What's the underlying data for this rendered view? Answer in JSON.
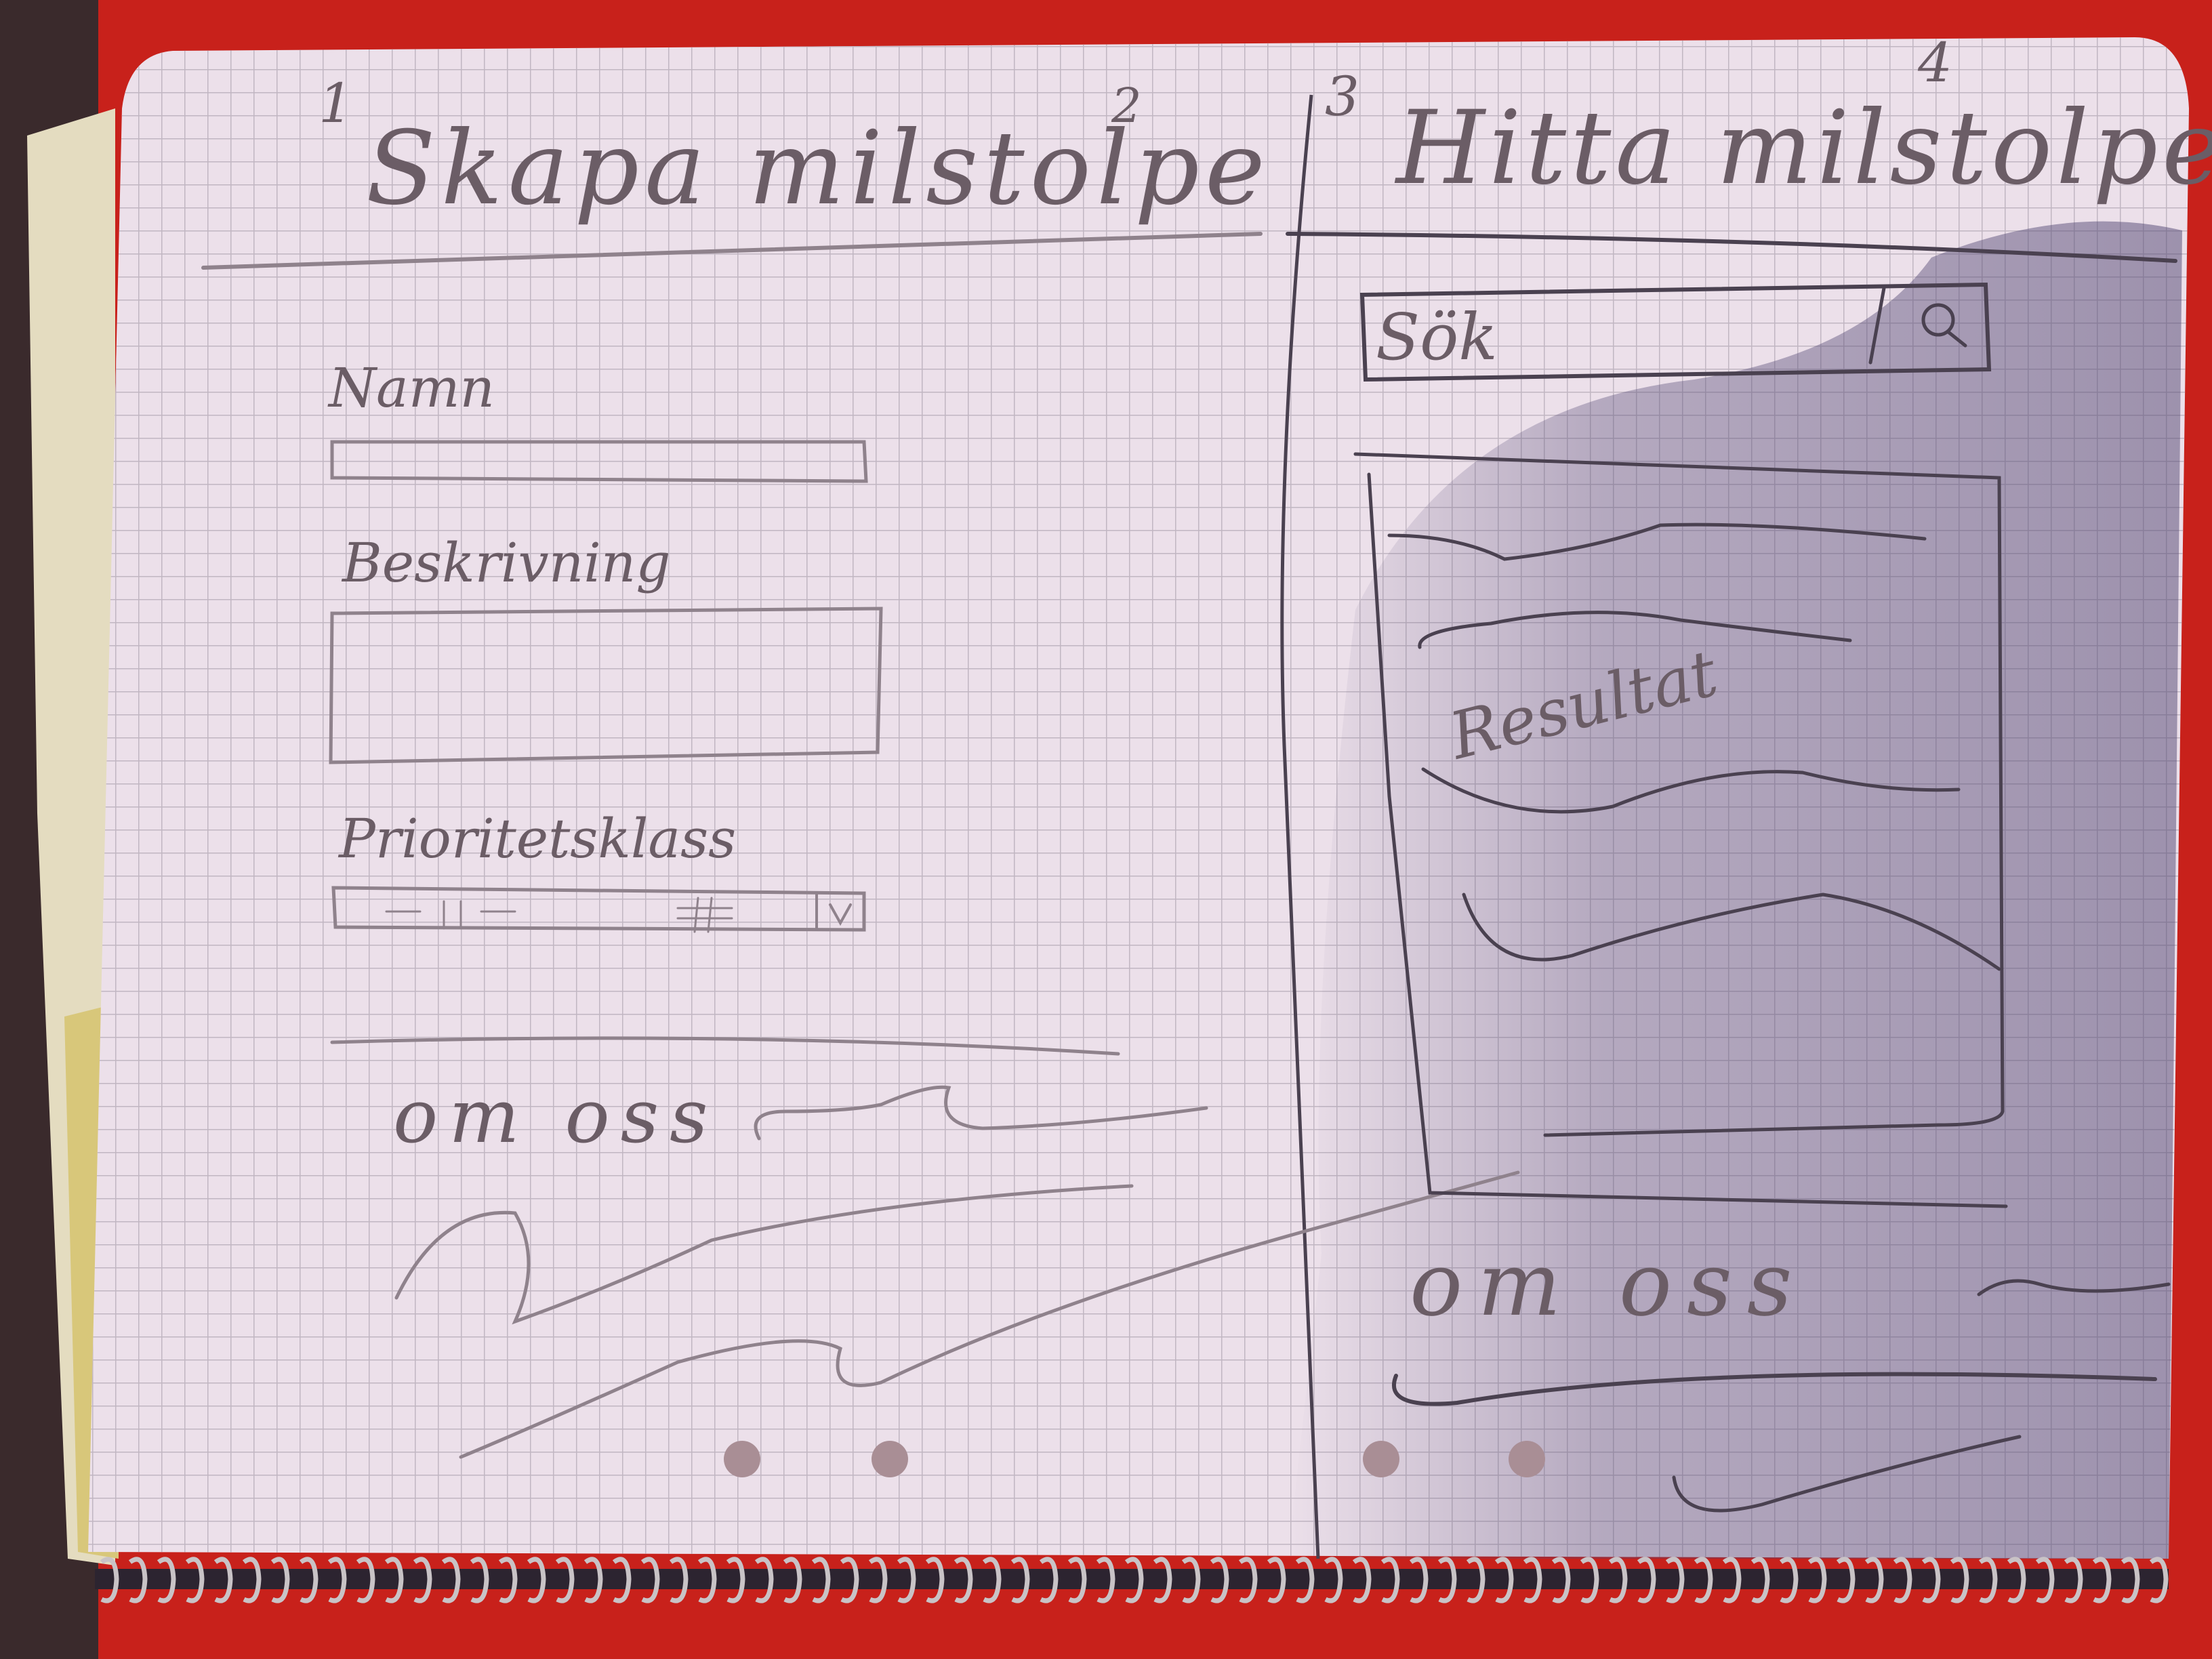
{
  "left_page": {
    "page_number": "1",
    "page_number_right": "2",
    "title": "Skapa milstolpe",
    "fields": [
      {
        "label": "Namn"
      },
      {
        "label": "Beskrivning"
      },
      {
        "label": "Prioritetsklass"
      }
    ],
    "footer_heading": "om oss"
  },
  "right_page": {
    "page_number": "3",
    "page_number_right": "4",
    "title": "Hitta milstolpe",
    "search_placeholder": "Sök",
    "search_icon": "magnifier-icon",
    "results_label": "Resultat",
    "footer_heading": "om oss"
  },
  "colors": {
    "table": "#c8211b",
    "paper": "#ece0ea",
    "grid": "#b9aebb",
    "pencil_left": "#8f828c",
    "pencil_right": "#4a4150",
    "shadow": "#4e4370"
  }
}
